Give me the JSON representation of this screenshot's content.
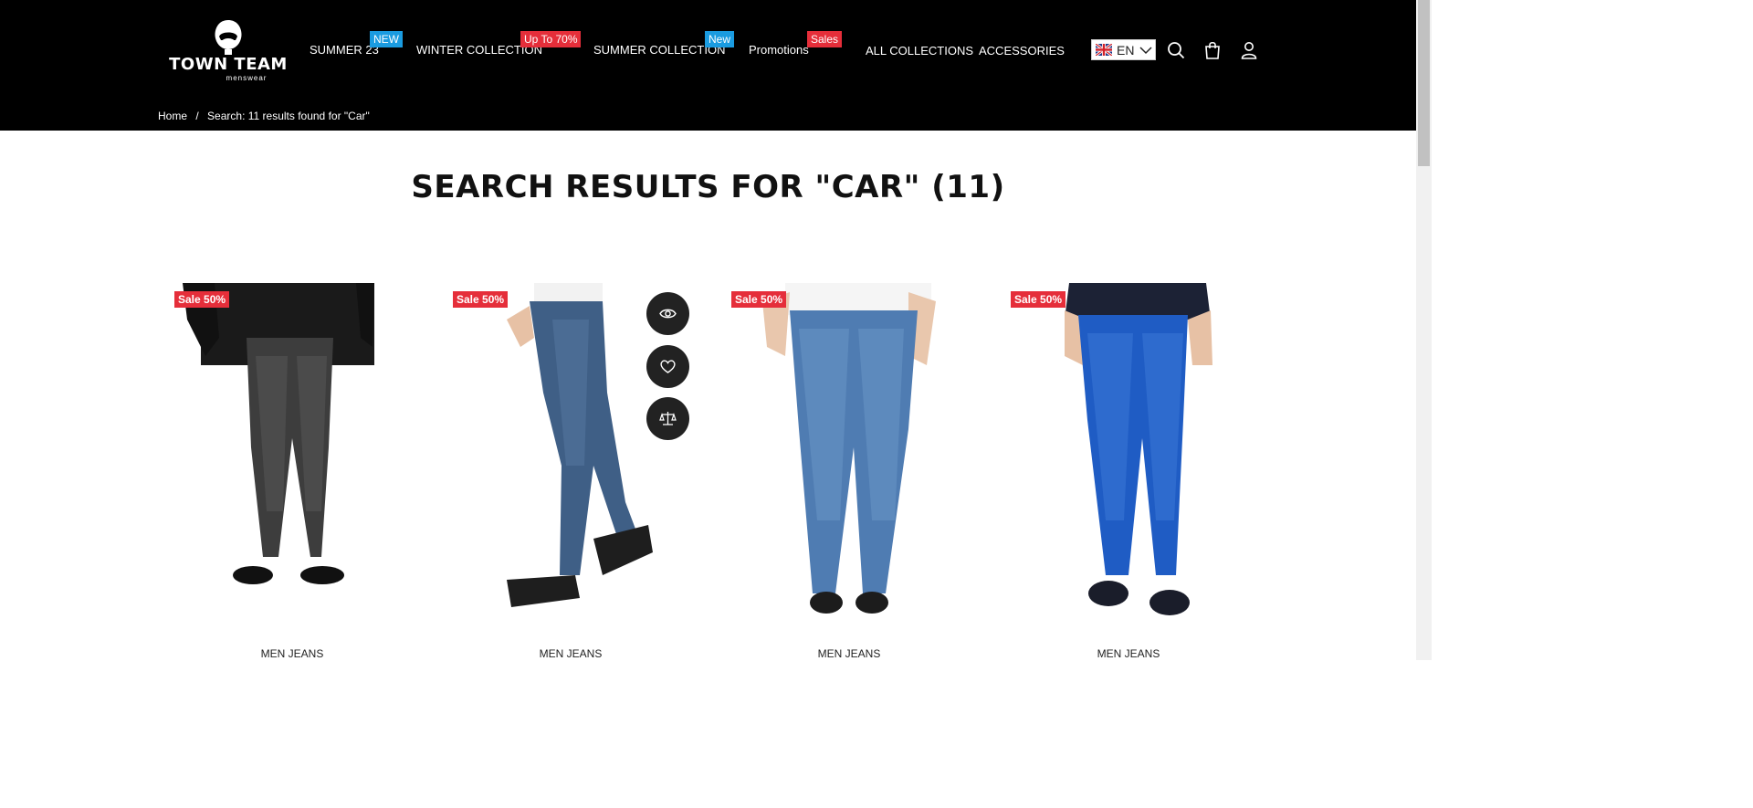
{
  "header": {
    "logo": {
      "brand": "TOWN TEAM",
      "sub": "menswear"
    },
    "nav": [
      {
        "label": "SUMMER 23",
        "badge": "NEW",
        "badge_color": "#1a9be0"
      },
      {
        "label": "WINTER COLLECTION",
        "badge": "Up To 70%",
        "badge_color": "#e52e3a"
      },
      {
        "label": "SUMMER COLLECTION",
        "badge": "New",
        "badge_color": "#1a9be0"
      },
      {
        "label": "Promotions",
        "badge": "Sales",
        "badge_color": "#e52e3a"
      },
      {
        "label": "ALL COLLECTIONS"
      },
      {
        "label": "ACCESSORIES"
      }
    ],
    "language": {
      "code": "EN",
      "flag": "uk-flag-icon"
    },
    "icons": [
      "search-icon",
      "cart-bag-icon",
      "user-account-icon"
    ]
  },
  "breadcrumb": {
    "home": "Home",
    "separator": "/",
    "current": "Search: 11 results found for \"Car\""
  },
  "main": {
    "title": "SEARCH RESULTS FOR \"CAR\" (11)",
    "products": [
      {
        "sale": "Sale 50%",
        "name": "MEN JEANS",
        "color": "black-wash"
      },
      {
        "sale": "Sale 50%",
        "name": "MEN JEANS",
        "color": "mid-blue"
      },
      {
        "sale": "Sale 50%",
        "name": "MEN JEANS",
        "color": "light-blue"
      },
      {
        "sale": "Sale 50%",
        "name": "MEN JEANS",
        "color": "bright-blue"
      }
    ],
    "quick_actions": [
      "quick-view-eye-icon",
      "wishlist-heart-icon",
      "compare-scale-icon"
    ]
  },
  "colors": {
    "header_bg": "#000000",
    "sale_red": "#e52e3a",
    "badge_blue": "#1a9be0",
    "action_bg": "#222222"
  }
}
